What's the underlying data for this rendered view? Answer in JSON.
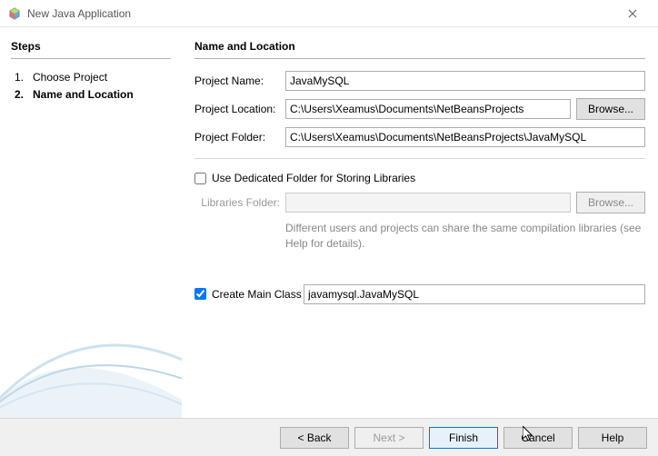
{
  "window": {
    "title": "New Java Application"
  },
  "sidebar": {
    "heading": "Steps",
    "steps": [
      {
        "num": "1.",
        "label": "Choose Project"
      },
      {
        "num": "2.",
        "label": "Name and Location"
      }
    ]
  },
  "main": {
    "heading": "Name and Location",
    "project_name_label": "Project Name:",
    "project_name_value": "JavaMySQL",
    "project_location_label": "Project Location:",
    "project_location_value": "C:\\Users\\Xeamus\\Documents\\NetBeansProjects",
    "browse_label": "Browse...",
    "project_folder_label": "Project Folder:",
    "project_folder_value": "C:\\Users\\Xeamus\\Documents\\NetBeansProjects\\JavaMySQL",
    "use_dedicated_label": "Use Dedicated Folder for Storing Libraries",
    "libraries_folder_label": "Libraries Folder:",
    "libraries_folder_value": "",
    "libraries_hint": "Different users and projects can share the same compilation libraries (see Help for details).",
    "create_main_label": "Create Main Class",
    "create_main_value": "javamysql.JavaMySQL"
  },
  "footer": {
    "back": "< Back",
    "next": "Next >",
    "finish": "Finish",
    "cancel": "Cancel",
    "help": "Help"
  }
}
